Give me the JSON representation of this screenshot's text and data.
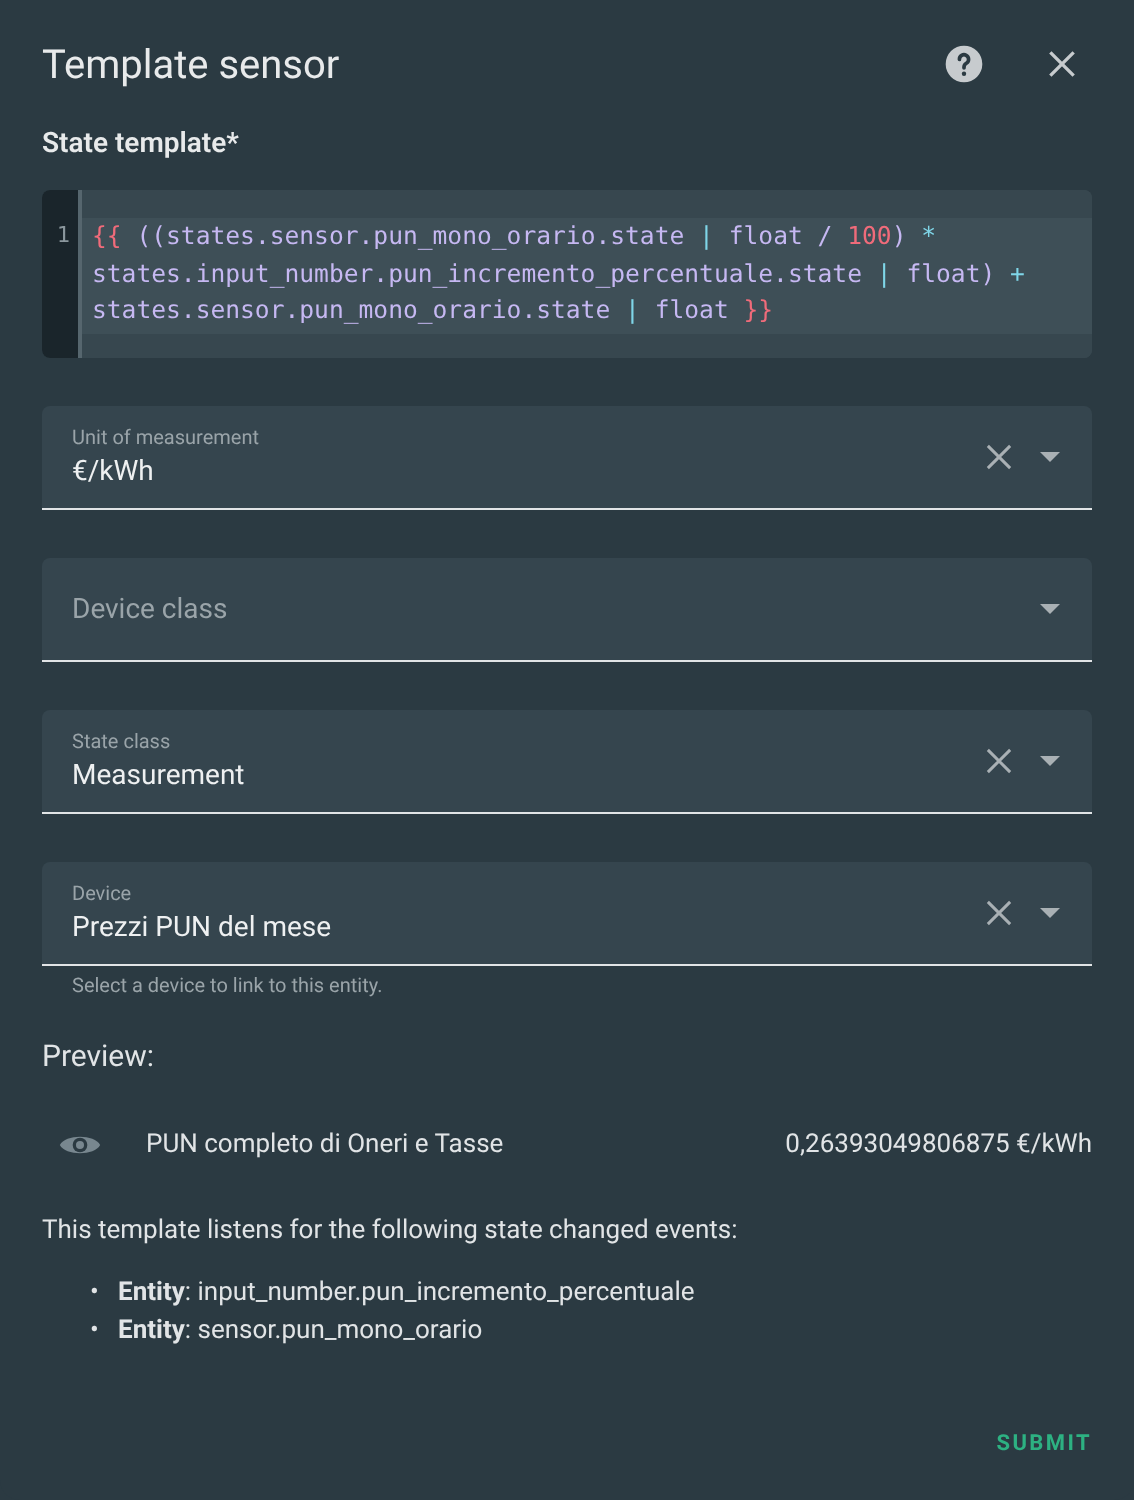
{
  "dialog": {
    "title": "Template sensor"
  },
  "template": {
    "label": "State template*",
    "line_number": "1",
    "tokens": [
      {
        "text": "{{",
        "kind": "brace"
      },
      {
        "text": " ((states.sensor.pun_mono_orario.state ",
        "kind": "plain"
      },
      {
        "text": "|",
        "kind": "operator"
      },
      {
        "text": " float / ",
        "kind": "plain"
      },
      {
        "text": "100",
        "kind": "number"
      },
      {
        "text": ") ",
        "kind": "plain"
      },
      {
        "text": "*",
        "kind": "operator"
      },
      {
        "text": " states.input_number.pun_incremento_percentuale.state ",
        "kind": "plain"
      },
      {
        "text": "|",
        "kind": "operator"
      },
      {
        "text": " float) ",
        "kind": "plain"
      },
      {
        "text": "+",
        "kind": "operator"
      },
      {
        "text": " states.sensor.pun_mono_orario.state ",
        "kind": "plain"
      },
      {
        "text": "|",
        "kind": "operator"
      },
      {
        "text": " float ",
        "kind": "plain"
      },
      {
        "text": "}}",
        "kind": "brace"
      }
    ]
  },
  "fields": [
    {
      "label": "Unit of measurement",
      "value": "€/kWh",
      "clearable": true
    },
    {
      "label": "Device class",
      "clearable": false
    },
    {
      "label": "State class",
      "value": "Measurement",
      "clearable": true
    },
    {
      "label": "Device",
      "value": "Prezzi PUN del mese",
      "clearable": true,
      "helper": "Select a device to link to this entity."
    }
  ],
  "preview": {
    "heading": "Preview:",
    "name": "PUN completo di Oneri e Tasse",
    "state": "0,26393049806875 €/kWh"
  },
  "listens": {
    "intro": "This template listens for the following state changed events:",
    "items": [
      {
        "bullet": "•",
        "text": "**Entity**: input_number.pun_incremento_percentuale"
      },
      {
        "bullet": "•",
        "text": "**Entity**: sensor.pun_mono_orario"
      }
    ]
  },
  "buttons": {
    "submit": "SUBMIT"
  }
}
